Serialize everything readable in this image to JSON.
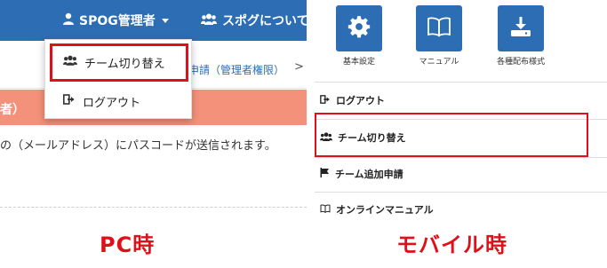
{
  "pc": {
    "nav": {
      "user_menu_label": "SPOG管理者",
      "about_label": "スポグについて"
    },
    "breadcrumb": "申請（管理者権限）",
    "breadcrumb_sep": ">",
    "alert_text": "者）",
    "description": "の（メールアドレス）にパスコードが送信されます。",
    "dropdown": {
      "team_switch": "チーム切り替え",
      "logout": "ログアウト"
    },
    "caption": "PC時"
  },
  "mobile": {
    "tiles": [
      {
        "icon": "gear-icon",
        "label": "基本設定"
      },
      {
        "icon": "book-icon",
        "label": "マニュアル"
      },
      {
        "icon": "download-icon",
        "label": "各種配布様式"
      }
    ],
    "menu": {
      "logout": "ログアウト",
      "team_switch": "チーム切り替え",
      "team_add": "チーム追加申請",
      "online_manual": "オンラインマニュアル"
    },
    "caption": "モバイル時"
  },
  "colors": {
    "brand_blue": "#2d6db4",
    "highlight_red": "#e0101a",
    "alert_salmon": "#f3917a"
  }
}
